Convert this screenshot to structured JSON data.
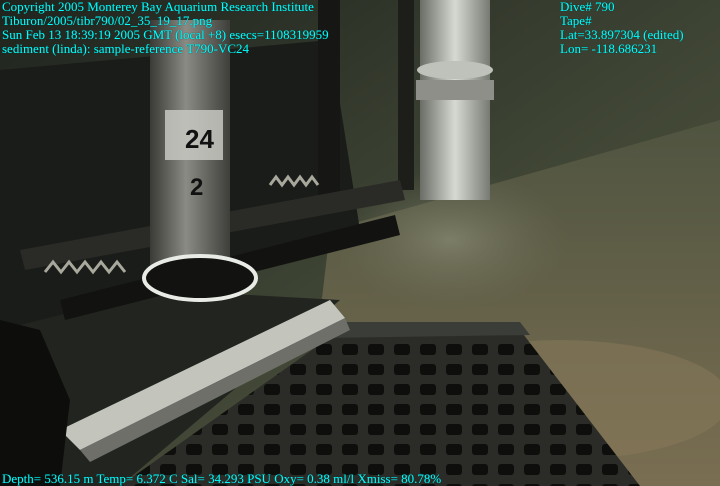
{
  "overlay": {
    "text_color": "#00ffff",
    "top_left": [
      "Copyright 2005 Monterey Bay Aquarium Research Institute",
      "Tiburon/2005/tibr790/02_35_19_17.png",
      "Sun Feb 13 18:39:19 2005 GMT (local +8)  esecs=1108319959",
      "sediment (linda): sample-reference T790-VC24"
    ],
    "top_right": [
      "Dive# 790",
      "Tape#",
      "Lat=33.897304 (edited)",
      "Lon= -118.686231"
    ],
    "bottom": "Depth= 536.15 m  Temp= 6.372 C  Sal= 34.293 PSU  Oxy= 0.38 ml/l  Xmiss= 80.78%"
  },
  "scene": {
    "core_labels": [
      "24",
      "2"
    ]
  }
}
